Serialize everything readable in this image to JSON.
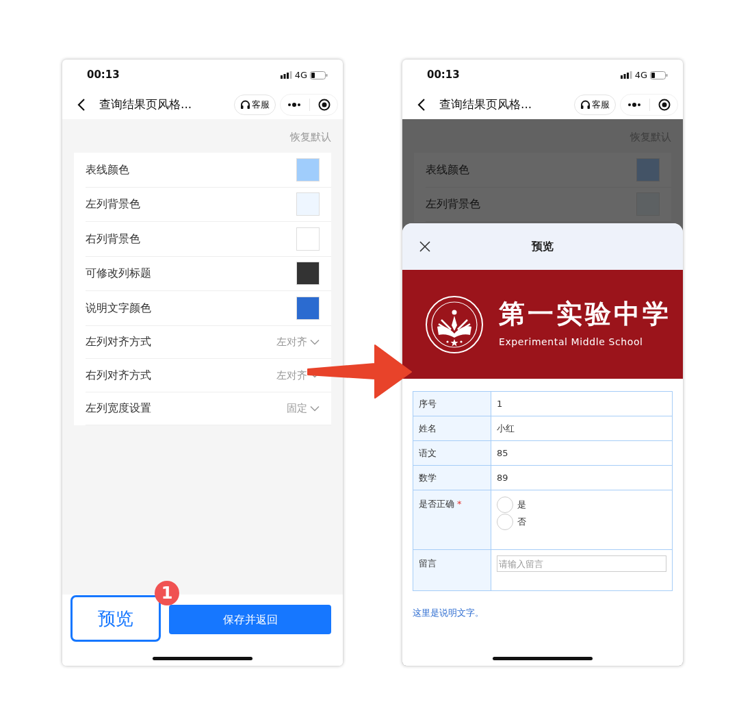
{
  "screens": [
    {
      "status_bar": {
        "time": "00:13",
        "network": "4G"
      },
      "nav": {
        "title": "查询结果页风格...",
        "service": "客服"
      },
      "dimmed": false,
      "reset": "恢复默认",
      "settings": [
        {
          "kind": "color",
          "label": "表线颜色",
          "color": "#a0cdfc"
        },
        {
          "kind": "color",
          "label": "左列背景色",
          "color": "#eef6ff"
        },
        {
          "kind": "color",
          "label": "右列背景色",
          "color": "#ffffff"
        },
        {
          "kind": "color",
          "label": "可修改列标题",
          "color": "#333333"
        },
        {
          "kind": "color",
          "label": "说明文字颜色",
          "color": "#2b6bd0"
        },
        {
          "kind": "select",
          "label": "左列对齐方式",
          "value": "左对齐"
        },
        {
          "kind": "select",
          "label": "右列对齐方式",
          "value": "左对齐"
        },
        {
          "kind": "select",
          "label": "左列宽度设置",
          "value": "固定"
        }
      ],
      "buttons": [
        {
          "kind": "outline",
          "label": "预览",
          "badge": "1"
        },
        {
          "kind": "primary",
          "label": "保存并返回"
        }
      ]
    },
    {
      "status_bar": {
        "time": "00:13",
        "network": "4G"
      },
      "nav": {
        "title": "查询结果页风格...",
        "service": "客服"
      },
      "dimmed": true,
      "reset": "恢复默认",
      "settings": [
        {
          "kind": "color",
          "label": "表线颜色",
          "color": "#435366"
        },
        {
          "kind": "color",
          "label": "左列背景色",
          "color": "#5d6163"
        }
      ],
      "sheet": {
        "title": "预览",
        "banner": {
          "name": "第一实验中学",
          "name_en": "Experimental Middle School"
        },
        "rows": [
          {
            "kind": "text",
            "label": "序号",
            "value": "1"
          },
          {
            "kind": "text",
            "label": "姓名",
            "value": "小红"
          },
          {
            "kind": "text",
            "label": "语文",
            "value": "85"
          },
          {
            "kind": "text",
            "label": "数学",
            "value": "89"
          },
          {
            "kind": "radio",
            "label": "是否正确",
            "required_mark": "*",
            "options": [
              {
                "label": "是",
                "selected": false
              },
              {
                "label": "否",
                "selected": false
              }
            ]
          },
          {
            "kind": "input",
            "label": "留言",
            "placeholder": "请输入留言"
          }
        ],
        "note": "这里是说明文字。"
      }
    }
  ]
}
